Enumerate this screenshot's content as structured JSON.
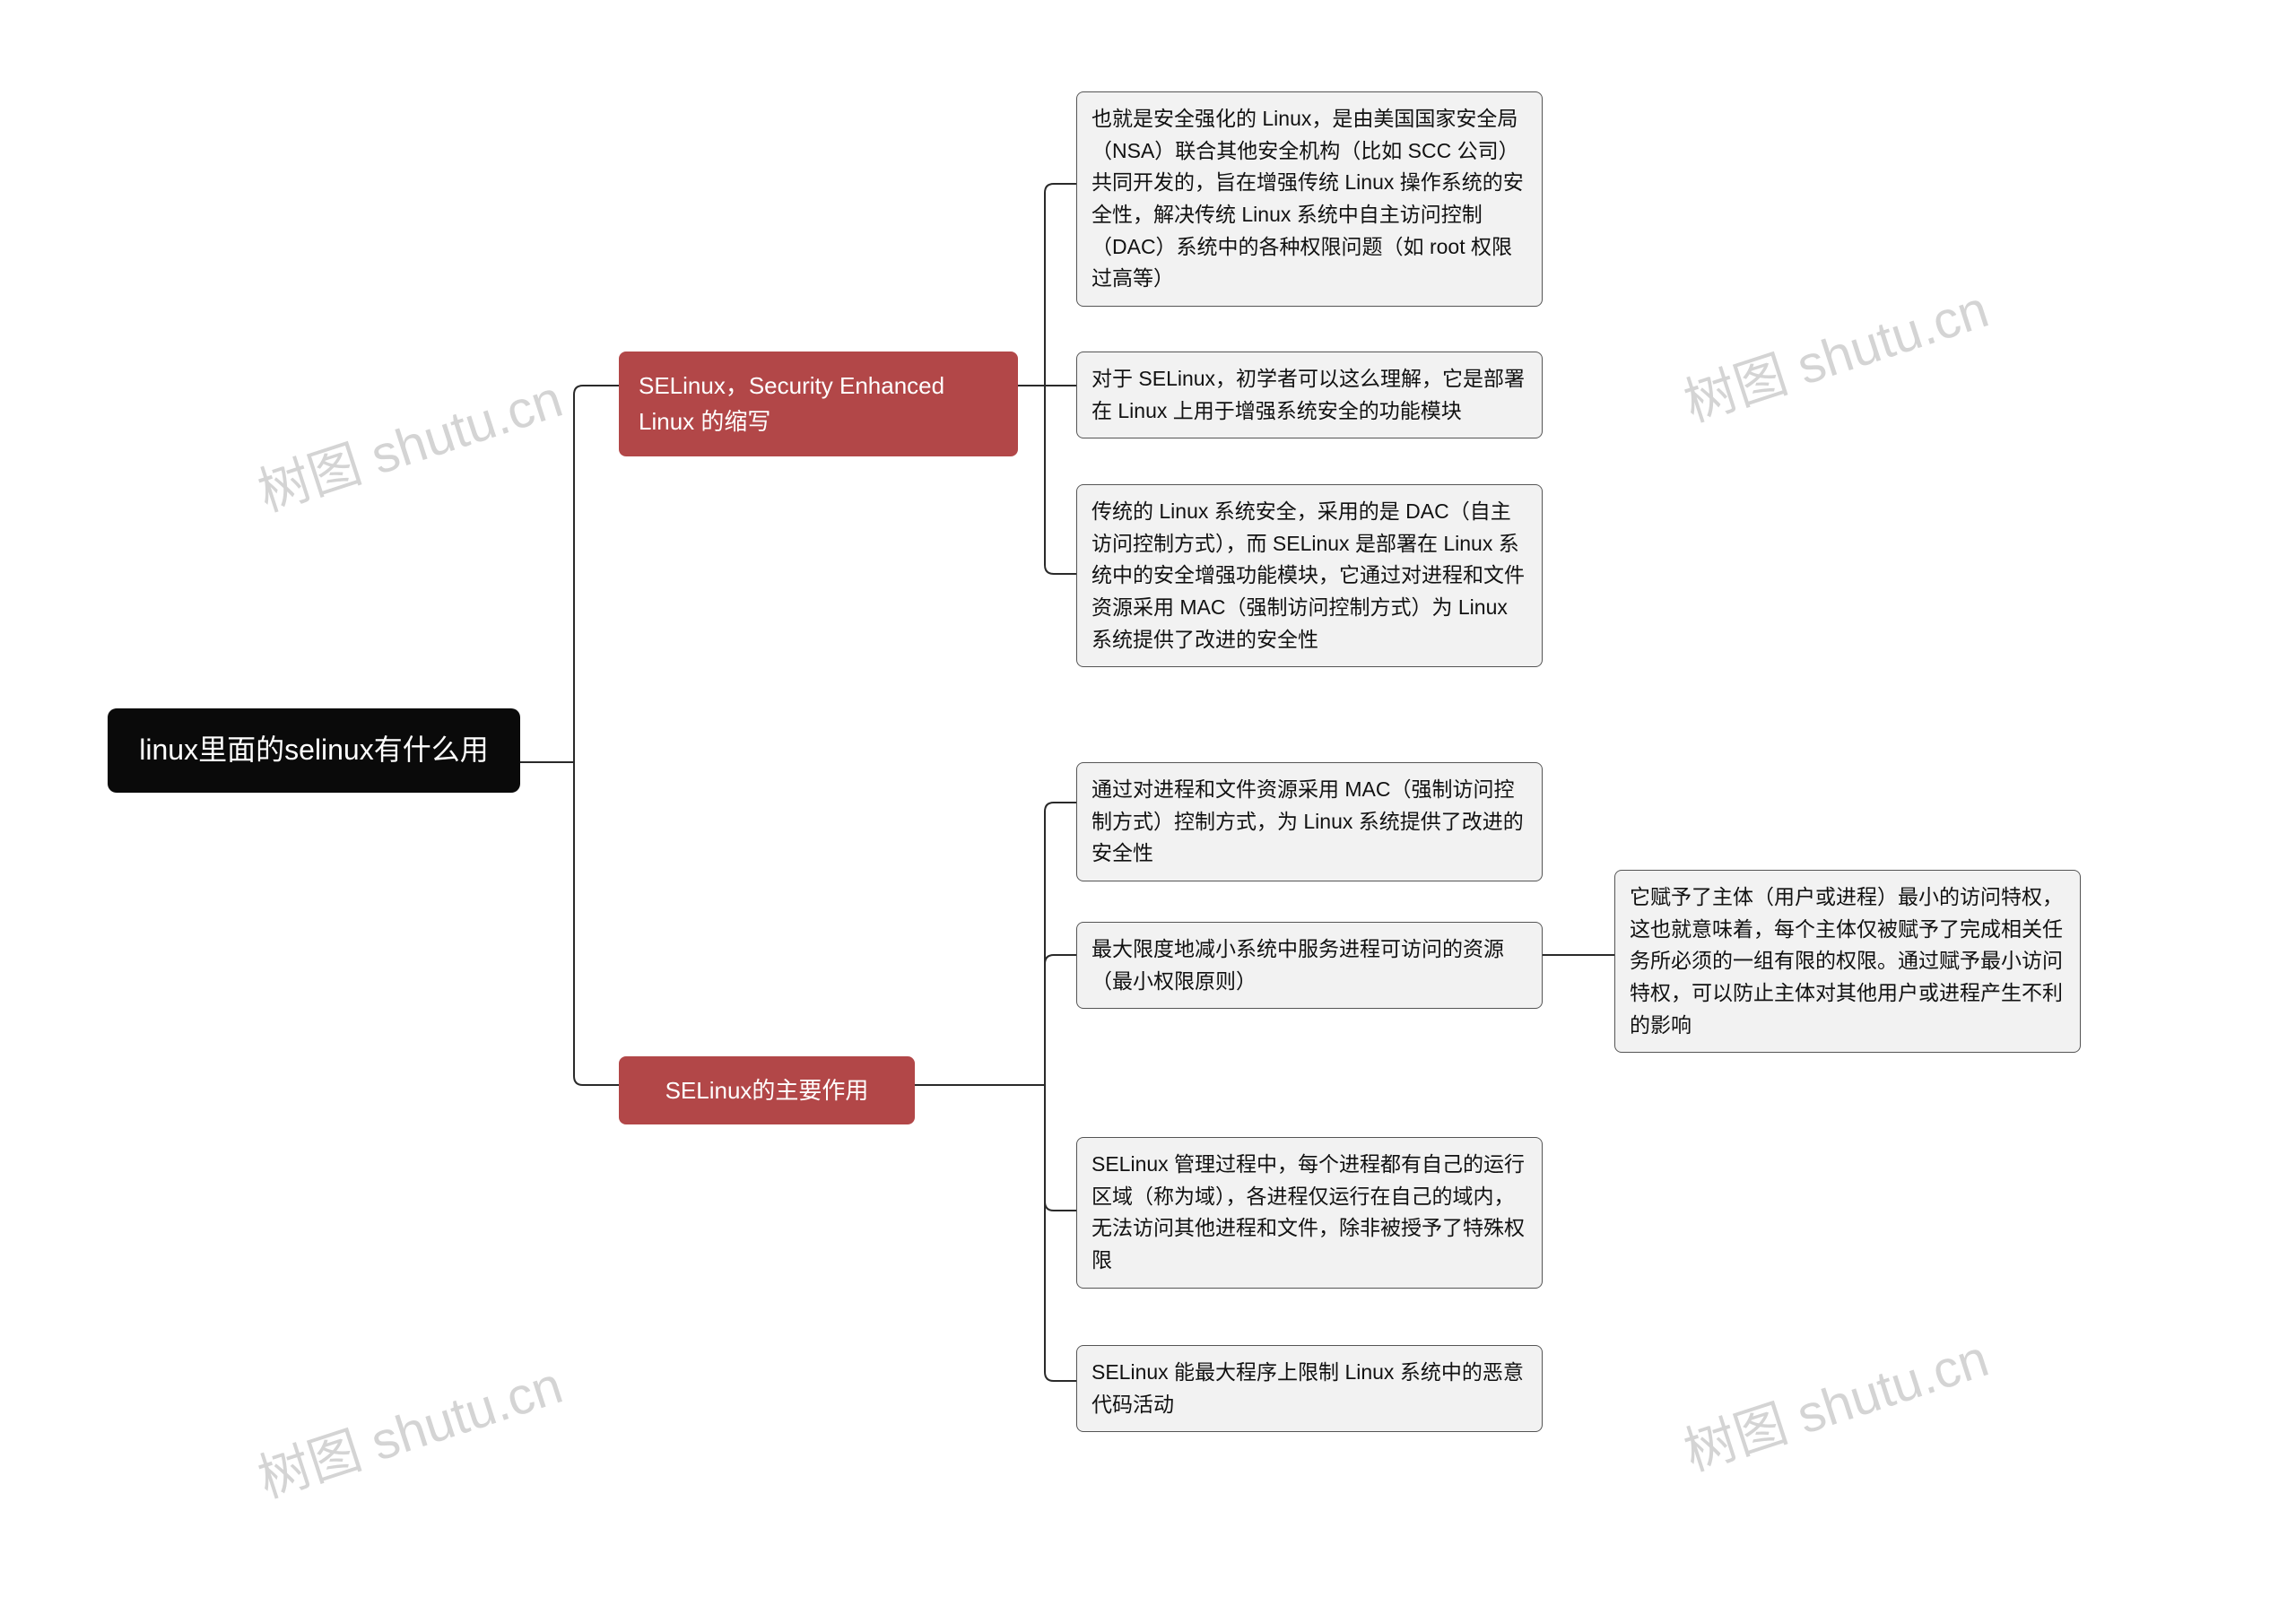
{
  "root": {
    "title": "linux里面的selinux有什么用"
  },
  "branch1": {
    "title": "SELinux，Security Enhanced Linux 的缩写",
    "leaf1": "也就是安全强化的 Linux，是由美国国家安全局（NSA）联合其他安全机构（比如 SCC 公司）共同开发的，旨在增强传统 Linux 操作系统的安全性，解决传统 Linux 系统中自主访问控制（DAC）系统中的各种权限问题（如 root 权限过高等）",
    "leaf2": "对于 SELinux，初学者可以这么理解，它是部署在 Linux 上用于增强系统安全的功能模块",
    "leaf3": "传统的 Linux 系统安全，采用的是 DAC（自主访问控制方式），而 SELinux 是部署在 Linux 系统中的安全增强功能模块，它通过对进程和文件资源采用 MAC（强制访问控制方式）为 Linux 系统提供了改进的安全性"
  },
  "branch2": {
    "title": "SELinux的主要作用",
    "leaf1": "通过对进程和文件资源采用 MAC（强制访问控制方式）控制方式，为 Linux 系统提供了改进的安全性",
    "leaf2": "最大限度地减小系统中服务进程可访问的资源（最小权限原则）",
    "leaf2_sub": "它赋予了主体（用户或进程）最小的访问特权，这也就意味着，每个主体仅被赋予了完成相关任务所必须的一组有限的权限。通过赋予最小访问特权，可以防止主体对其他用户或进程产生不利的影响",
    "leaf3": "SELinux 管理过程中，每个进程都有自己的运行区域（称为域），各进程仅运行在自己的域内，无法访问其他进程和文件，除非被授予了特殊权限",
    "leaf4": "SELinux 能最大程序上限制 Linux 系统中的恶意代码活动"
  },
  "watermark": "树图 shutu.cn"
}
